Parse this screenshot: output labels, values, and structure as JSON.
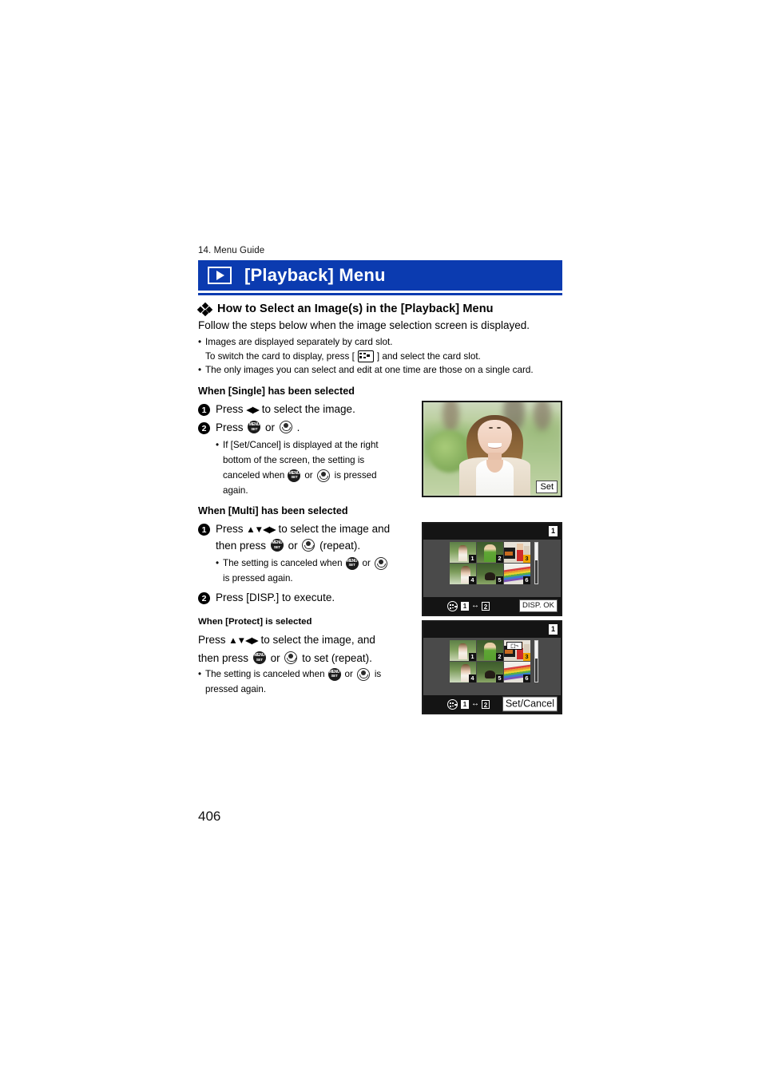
{
  "running_head": "14. Menu Guide",
  "chapter": {
    "icon": "playback-triangle-icon",
    "title": "[Playback] Menu",
    "bar_color": "#0b3bb0"
  },
  "section": {
    "heading": "How to Select an Image(s) in the [Playback] Menu",
    "intro": "Follow the steps below when the image selection screen is displayed.",
    "notes": [
      "Images are displayed separately by card slot.",
      "The only images you can select and edit at one time are those on a single card."
    ],
    "note_sub_prefix": "To switch the card to display, press [",
    "note_sub_suffix": "] and select the card slot."
  },
  "single": {
    "heading": "When [Single] has been selected",
    "step1_num": "1",
    "step1_a": "Press",
    "step1_arrows": "◀▶",
    "step1_b": "to select the image.",
    "step2_num": "2",
    "step2_a": "Press",
    "step2_or": "or",
    "step2_end": ".",
    "bullet_l1": "If [Set/Cancel] is displayed at the right",
    "bullet_l2": "bottom of the screen, the setting is",
    "bullet_l3_a": "canceled when",
    "bullet_l3_or": "or",
    "bullet_l3_b": "is pressed",
    "bullet_l4": "again."
  },
  "multi": {
    "heading": "When [Multi] has been selected",
    "step1_num": "1",
    "step1_a": "Press",
    "step1_arrows": "▲▼◀▶",
    "step1_b": "to select the image and",
    "step1_c": "then press",
    "step1_or": "or",
    "step1_d": "(repeat).",
    "bullet_a": "The setting is canceled when",
    "bullet_or": "or",
    "bullet_b": "is pressed again.",
    "step2_num": "2",
    "step2_text": "Press [DISP.] to execute."
  },
  "protect": {
    "heading": "When [Protect] is selected",
    "line1_a": "Press",
    "line1_arrows": "▲▼◀▶",
    "line1_b": "to select the image, and",
    "line2_a": "then press",
    "line2_or": "or",
    "line2_b": "to set (repeat).",
    "bullet_a": "The setting is canceled when",
    "bullet_or": "or",
    "bullet_b": "is",
    "bullet_c": "pressed again."
  },
  "screens": {
    "single": {
      "set_label": "Set"
    },
    "multi": {
      "slot_badge": "1",
      "thumbs": [
        {
          "n": "1",
          "selected": false
        },
        {
          "n": "2",
          "selected": false
        },
        {
          "n": "3",
          "selected": true
        },
        {
          "n": "4",
          "selected": false
        },
        {
          "n": "5",
          "selected": false
        },
        {
          "n": "6",
          "selected": false
        }
      ],
      "slot_from": "1",
      "slot_arrow": "↔",
      "slot_to": "2",
      "action_label": "DISP. OK"
    },
    "protect": {
      "slot_badge": "1",
      "thumbs": [
        {
          "n": "1",
          "selected": false
        },
        {
          "n": "2",
          "selected": false
        },
        {
          "n": "3",
          "selected": true
        },
        {
          "n": "4",
          "selected": false
        },
        {
          "n": "5",
          "selected": false
        },
        {
          "n": "6",
          "selected": false
        }
      ],
      "protect_icon_label": "⬚¬",
      "slot_from": "1",
      "slot_arrow": "↔",
      "slot_to": "2",
      "action_label": "Set/Cancel"
    }
  },
  "page_number": "406",
  "glyphs": {
    "menuset_line1": "MENU",
    "menuset_line2": "SET"
  }
}
